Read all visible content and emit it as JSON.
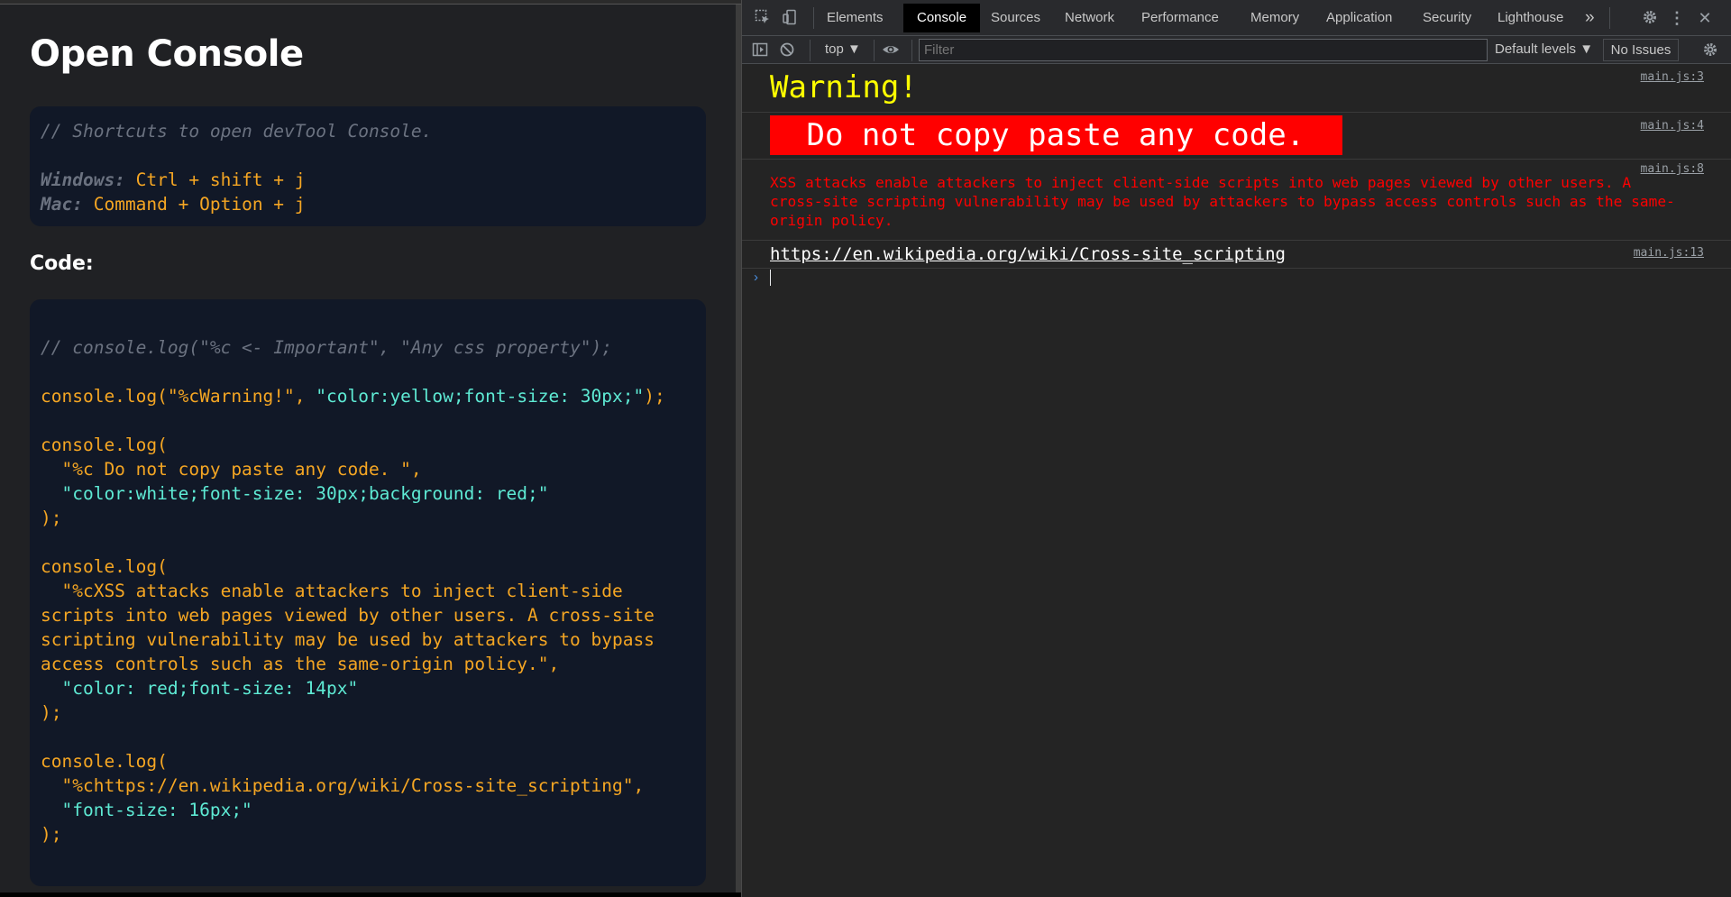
{
  "page": {
    "title": "Open Console",
    "shortcuts": {
      "comment": "// Shortcuts to open devTool Console.",
      "windows_label": "Windows:",
      "windows_keys": "Ctrl + shift + j",
      "mac_label": "Mac:",
      "mac_keys": "Command + Option + j"
    },
    "code_label": "Code:",
    "code": {
      "comment": "// console.log(\"%c <- Important\", \"Any css property\");",
      "l1_pre": "console.log(",
      "l1_str1": "\"%cWarning!\"",
      "l1_comma": ", ",
      "l1_str2": "\"color:yellow;font-size: 30px;\"",
      "l1_end": ");",
      "b2_open": "console.log(",
      "b2_str1": "  \"%c Do not copy paste any code. \",",
      "b2_str2": "  \"color:white;font-size: 30px;background: red;\"",
      "b2_close": ");",
      "b3_open": "console.log(",
      "b3_l1": "  \"%cXSS attacks enable attackers to inject client-side",
      "b3_l2": "scripts into web pages viewed by other users. A cross-site",
      "b3_l3": "scripting vulnerability may be used by attackers to bypass",
      "b3_l4": "access controls such as the same-origin policy.\",",
      "b3_str2": "  \"color: red;font-size: 14px\"",
      "b3_close": ");",
      "b4_open": "console.log(",
      "b4_str1": "  \"%chttps://en.wikipedia.org/wiki/Cross-site_scripting\",",
      "b4_str2": "  \"font-size: 16px;\"",
      "b4_close": ");"
    }
  },
  "devtools": {
    "tabs": [
      "Elements",
      "Console",
      "Sources",
      "Network",
      "Performance",
      "Memory",
      "Application",
      "Security",
      "Lighthouse"
    ],
    "active_tab": "Console",
    "more_tabs_icon": "»",
    "context": "top ▼",
    "filter_placeholder": "Filter",
    "levels": "Default levels ▼",
    "issues": "No Issues",
    "messages": [
      {
        "text": "Warning!",
        "source": "main.js:3"
      },
      {
        "text": " Do not copy paste any code. ",
        "source": "main.js:4"
      },
      {
        "text": "XSS attacks enable attackers to inject client-side scripts into web pages viewed by other users. A cross-site scripting vulnerability may be used by attackers to bypass access controls such as the same-origin policy.",
        "source": "main.js:8"
      },
      {
        "text": "https://en.wikipedia.org/wiki/Cross-site_scripting",
        "source": "main.js:13"
      }
    ],
    "prompt_icon": "›"
  },
  "colors": {
    "page_bg": "#202124",
    "code_bg": "#111827",
    "code_orange": "#f5a623",
    "code_string": "#5eead4",
    "warning_yellow": "#ffff00",
    "alert_red": "#ff0000"
  }
}
